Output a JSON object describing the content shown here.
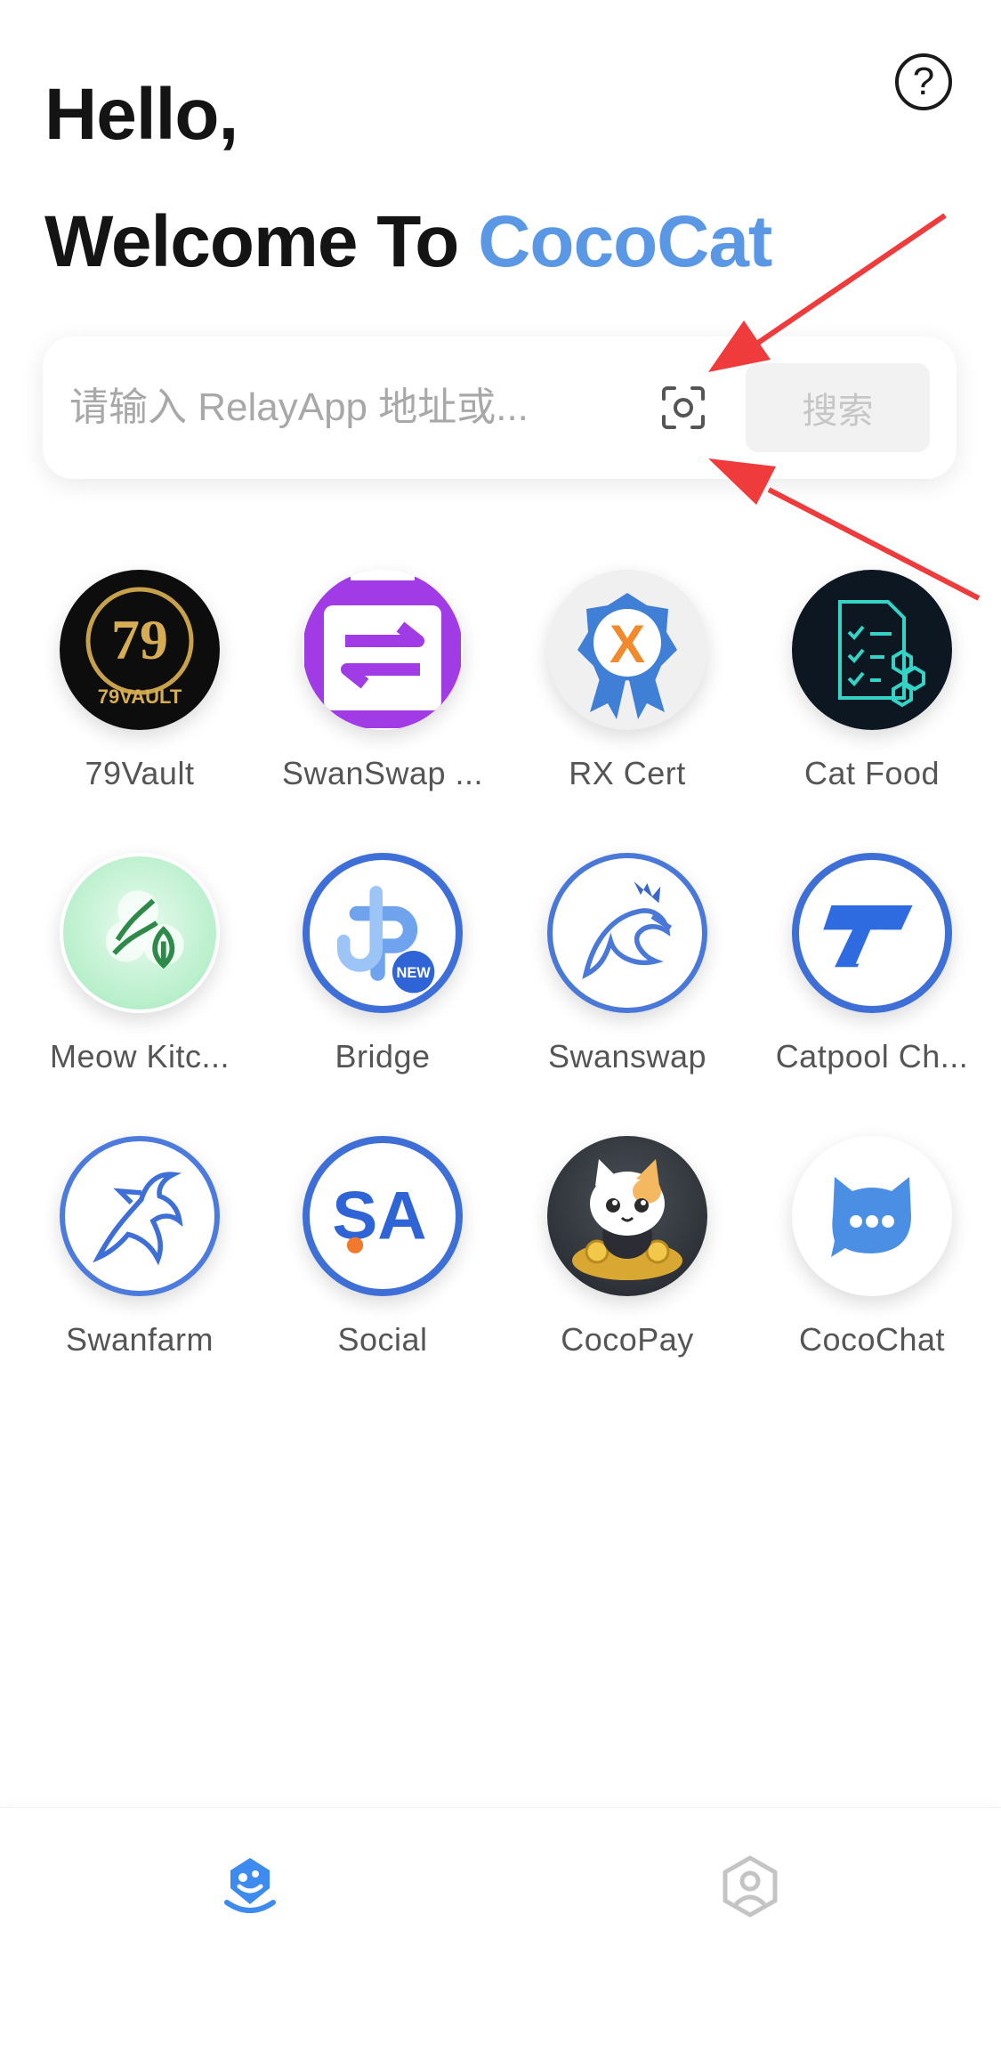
{
  "header": {
    "greeting": "Hello,",
    "welcome_prefix": "Welcome To ",
    "brand": "CocoCat",
    "help_glyph": "?"
  },
  "search": {
    "placeholder": "请输入 RelayApp 地址或...",
    "value": "",
    "scan_icon": "scan-icon",
    "button_label": "搜索"
  },
  "apps": [
    {
      "label": "79Vault",
      "icon": "79vault-icon"
    },
    {
      "label": "SwanSwap ...",
      "icon": "swanswap-calendar-icon"
    },
    {
      "label": "RX Cert",
      "icon": "rx-cert-badge-icon"
    },
    {
      "label": "Cat Food",
      "icon": "cat-food-document-icon"
    },
    {
      "label": "Meow Kitc...",
      "icon": "meow-kitchen-leaf-icon"
    },
    {
      "label": "Bridge",
      "icon": "bridge-icon"
    },
    {
      "label": "Swanswap",
      "icon": "swan-icon"
    },
    {
      "label": "Catpool Ch...",
      "icon": "catpool-icon"
    },
    {
      "label": "Swanfarm",
      "icon": "swanfarm-icon"
    },
    {
      "label": "Social",
      "icon": "social-sa-icon"
    },
    {
      "label": "CocoPay",
      "icon": "cocopay-cat-icon"
    },
    {
      "label": "CocoChat",
      "icon": "cocochat-icon"
    }
  ],
  "badges": {
    "bridge_new": "NEW",
    "vault_text": "79VAULT",
    "vault_number": "79",
    "social_text": "SA"
  },
  "tabbar": {
    "tabs": [
      {
        "icon": "discover-icon",
        "active": true
      },
      {
        "icon": "profile-hexagon-icon",
        "active": false
      }
    ]
  },
  "colors": {
    "brand": "#5a97e4",
    "tab_active": "#3d8bef",
    "tab_inactive": "#c4c4c4",
    "annotation_arrow": "#ef3b3b"
  }
}
